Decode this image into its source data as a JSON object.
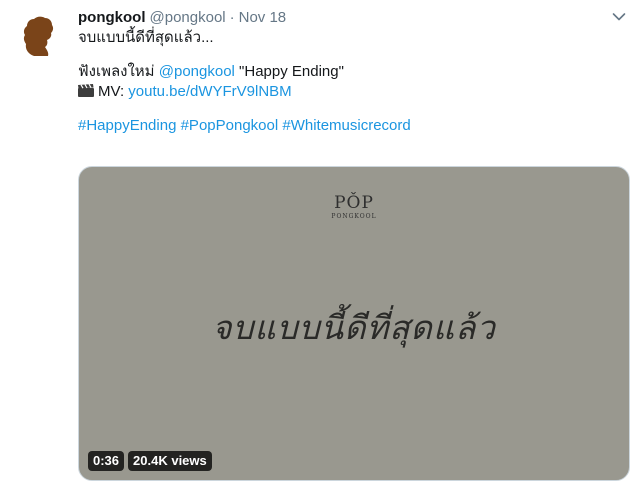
{
  "tweet": {
    "display_name": "pongkool",
    "handle": "@pongkool",
    "separator": "·",
    "date": "Nov 18",
    "lines": [
      {
        "text": "จบแบบนี้ดีที่สุดแล้ว..."
      }
    ],
    "line2_prefix": "ฟังเพลงใหม่ ",
    "line2_mention": "@pongkool",
    "line2_suffix": " \"Happy Ending\"",
    "mv_label": "MV: ",
    "mv_link": "youtu.be/dWYFrV9lNBM",
    "hashtags": [
      "#HappyEnding",
      "#PopPongkool",
      "#Whitemusicrecord"
    ]
  },
  "media": {
    "logo_main": "PǑP",
    "logo_sub": "PONGKOOL",
    "video_title": "จบแบบนี้ดีที่สุดแล้ว",
    "duration": "0:36",
    "views": "20.4K views"
  },
  "colors": {
    "link": "#1b95e0",
    "media_bg": "#99988f",
    "avatar_silhouette": "#7a4419"
  },
  "icons": {
    "chevron": "chevron-down-icon",
    "clapper": "clapper-board-icon"
  }
}
